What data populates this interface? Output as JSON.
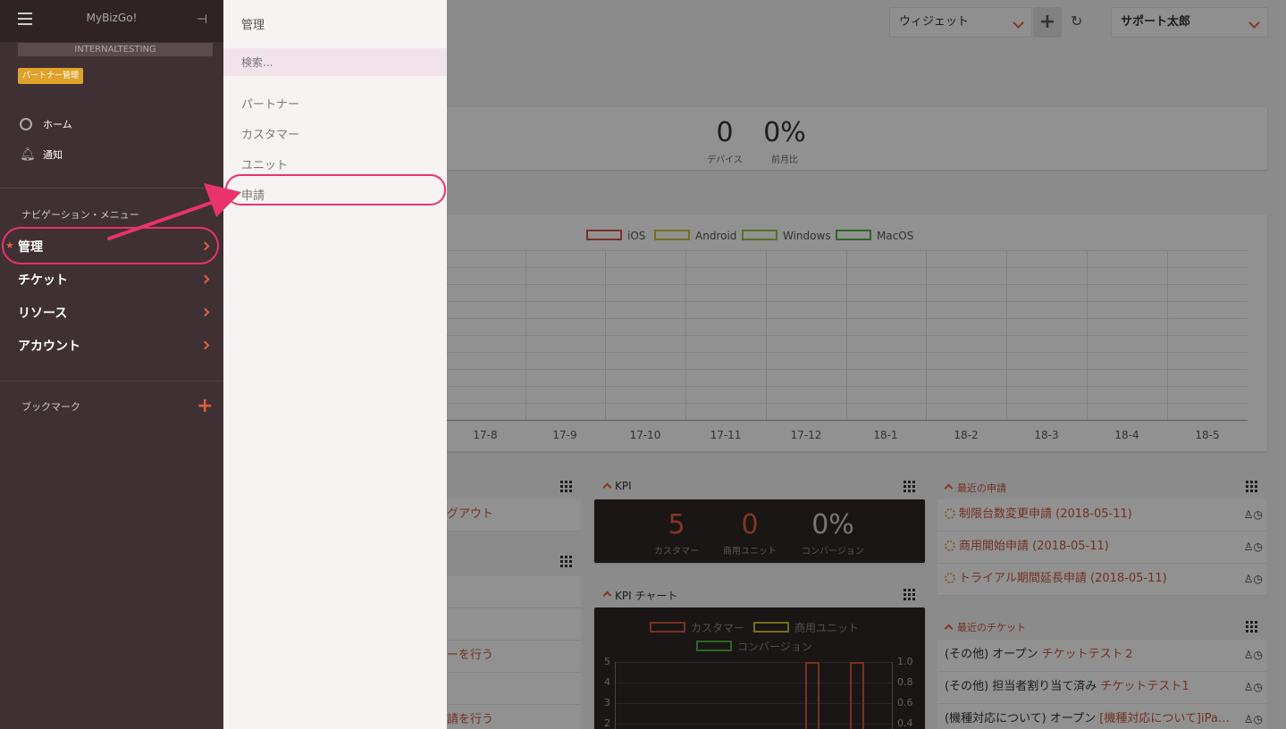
{
  "header": {
    "widget_select": "ウィジェット",
    "user_select": "サポート太郎"
  },
  "stats": {
    "devices_value": "0",
    "devices_label": "デバイス",
    "mom_value": "0%",
    "mom_label": "前月比"
  },
  "device_chart": {
    "legend": [
      "iOS",
      "Android",
      "Windows",
      "MacOS"
    ],
    "x_ticks": [
      "17-8",
      "17-9",
      "17-10",
      "17-11",
      "17-12",
      "18-1",
      "18-2",
      "18-3",
      "18-4",
      "18-5"
    ],
    "legend_colors": [
      "#d2553e",
      "#c8c030",
      "#98c040",
      "#50b040"
    ]
  },
  "left_widgets": {
    "row1_text": "グアウト",
    "row2_text": "ーを行う",
    "row3_text": "請を行う"
  },
  "kpi": {
    "title": "KPI",
    "customers_value": "5",
    "customers_label": "カスタマー",
    "units_value": "0",
    "units_label": "商用ユニット",
    "conversion_value": "0%",
    "conversion_label": "コンバージョン"
  },
  "kpi_chart": {
    "title": "KPI チャート",
    "legend": [
      "カスタマー",
      "商用ユニット",
      "コンバージョン"
    ],
    "y_left": [
      "5",
      "4",
      "3",
      "2"
    ],
    "y_right": [
      "1.0",
      "0.8",
      "0.6",
      "0.4"
    ]
  },
  "recent_applications": {
    "title": "最近の申請",
    "items": [
      "制限台数変更申請 (2018-05-11)",
      "商用開始申請 (2018-05-11)",
      "トライアル期間延長申請 (2018-05-11)"
    ]
  },
  "recent_tickets": {
    "title": "最近のチケット",
    "items": [
      {
        "prefix": "(その他) オープン",
        "link": "チケットテスト２"
      },
      {
        "prefix": "(その他) 担当者割り当て済み",
        "link": "チケットテスト1"
      },
      {
        "prefix": "(機種対応について) オープン",
        "link": "[機種対応について]iPa…"
      }
    ]
  },
  "sidebar": {
    "brand": "MyBizGo!",
    "env": "INTERNALTESTING",
    "badge": "パートナー管理",
    "home": "ホーム",
    "notify": "通知",
    "nav_heading": "ナビゲーション・メニュー",
    "nav": [
      "管理",
      "チケット",
      "リソース",
      "アカウント"
    ],
    "bookmark": "ブックマーク"
  },
  "submenu": {
    "title": "管理",
    "search_placeholder": "検索...",
    "items": [
      "パートナー",
      "カスタマー",
      "ユニット",
      "申請"
    ]
  },
  "colors": {
    "accent": "#e0603e",
    "highlight": "#e8336d",
    "sidebar": "#3f3034"
  }
}
